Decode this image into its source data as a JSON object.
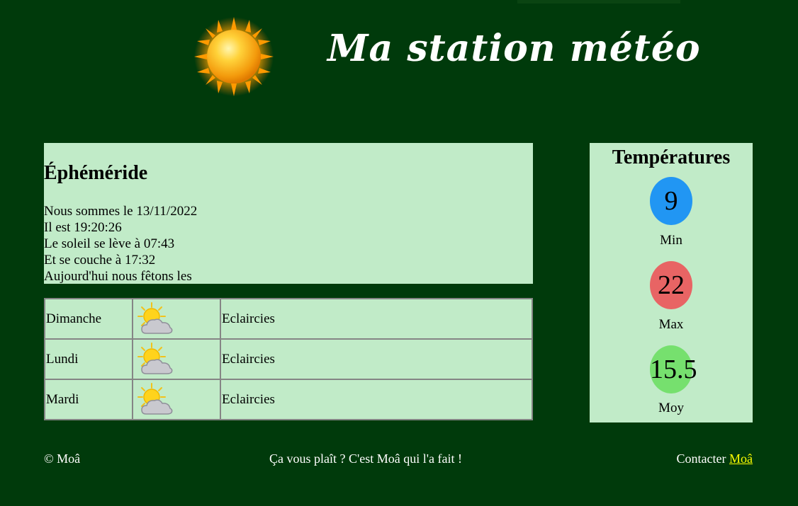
{
  "header": {
    "title": "Ma station météo",
    "logo_icon": "sun-icon"
  },
  "ephemeride": {
    "title": "Éphéméride",
    "lines": [
      "Nous sommes le 13/11/2022",
      "Il est 19:20:26",
      "Le soleil se lève à 07:43",
      "Et se couche à 17:32",
      "Aujourd'hui nous fêtons les"
    ]
  },
  "forecast": [
    {
      "day": "Dimanche",
      "icon": "sun-behind-cloud-icon",
      "desc": "Eclaircies"
    },
    {
      "day": "Lundi",
      "icon": "sun-behind-cloud-icon",
      "desc": "Eclaircies"
    },
    {
      "day": "Mardi",
      "icon": "sun-behind-cloud-icon",
      "desc": "Eclaircies"
    }
  ],
  "temperatures": {
    "title": "Températures",
    "items": [
      {
        "value": "9",
        "label": "Min",
        "color": "#2196f3"
      },
      {
        "value": "22",
        "label": "Max",
        "color": "#e86464"
      },
      {
        "value": "15.5",
        "label": "Moy",
        "color": "#76e06e"
      }
    ]
  },
  "footer": {
    "copyright": "© Moâ",
    "tagline": "Ça vous plaît ? C'est Moâ qui l'a fait !",
    "contact_prefix": "Contacter ",
    "contact_link": "Moâ"
  },
  "colors": {
    "background": "#003a0b",
    "panel": "#c1ebc8",
    "link": "#ffff00"
  }
}
